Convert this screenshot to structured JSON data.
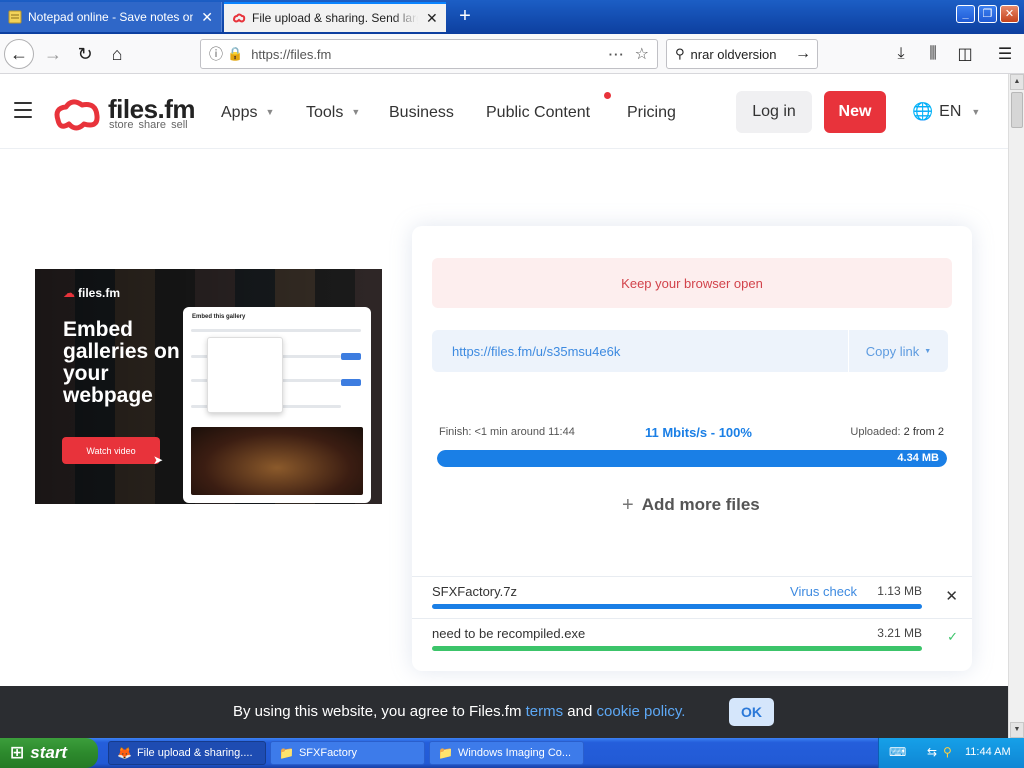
{
  "browser": {
    "tabs": [
      {
        "title": "Notepad online - Save notes online",
        "favicon": "notepad-icon",
        "active": false
      },
      {
        "title": "File upload & sharing. Send large p",
        "favicon": "filesfm-icon",
        "active": true
      }
    ],
    "url": "https://files.fm",
    "search_value": "nrar oldversion"
  },
  "site": {
    "brand": "files.fm",
    "tagline": "store  share  sell",
    "nav": {
      "apps": "Apps",
      "tools": "Tools",
      "business": "Business",
      "public_content": "Public Content",
      "pricing": "Pricing"
    },
    "login": "Log in",
    "new": "New",
    "language": "EN",
    "accent_color": "#e8333b"
  },
  "promo": {
    "logo": "files.fm",
    "headline": "Embed galleries on your webpage",
    "button": "Watch video",
    "card_title": "Embed this gallery"
  },
  "upload": {
    "notice": "Keep your browser open",
    "link": "https://files.fm/u/s35msu4e6k",
    "copy_link": "Copy link",
    "finish": "Finish: <1 min around 11:44",
    "speed": "11 Mbits/s - 100%",
    "uploaded_label": "Uploaded:",
    "uploaded_value": "2 from 2",
    "total_size": "4.34 MB",
    "progress_percent": 100,
    "add_more": "Add more files",
    "files": [
      {
        "name": "SFXFactory.7z",
        "size": "1.13 MB",
        "virus_check": "Virus check",
        "progress_percent": 100,
        "action_icon": "close-icon"
      },
      {
        "name": "need to be recompiled.exe",
        "size": "3.21 MB",
        "virus_check": "",
        "progress_percent": 100,
        "action_icon": "check-icon"
      }
    ]
  },
  "cookie": {
    "text_before": "By using this website, you agree to Files.fm ",
    "terms": "terms",
    "and": " and ",
    "policy": "cookie policy.",
    "ok": "OK"
  },
  "taskbar": {
    "start": "start",
    "tasks": [
      "File upload & sharing....",
      "SFXFactory",
      "Windows Imaging Co..."
    ],
    "clock": "11:44 AM"
  }
}
